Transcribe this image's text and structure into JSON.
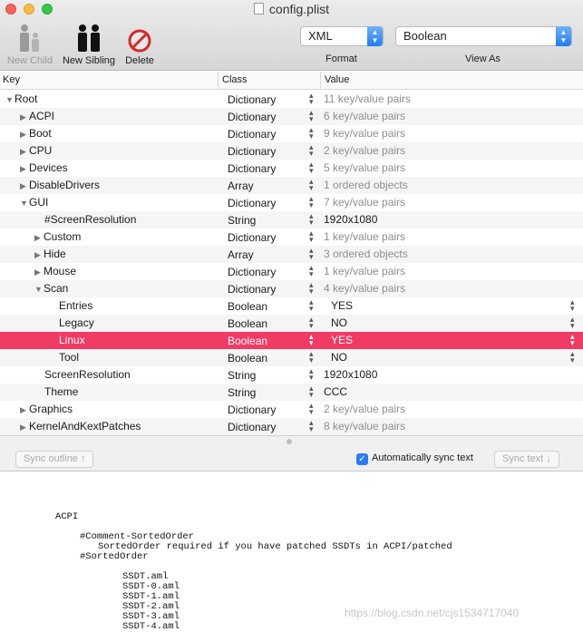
{
  "window": {
    "title": "config.plist"
  },
  "toolbar": {
    "new_child": "New Child",
    "new_sibling": "New Sibling",
    "delete": "Delete",
    "format_value": "XML",
    "format_caption": "Format",
    "viewas_value": "Boolean",
    "viewas_caption": "View As"
  },
  "columns": {
    "key": "Key",
    "class": "Class",
    "value": "Value"
  },
  "rows": [
    {
      "key": "Root",
      "class": "Dictionary",
      "value": "11 key/value pairs"
    },
    {
      "key": "ACPI",
      "class": "Dictionary",
      "value": "6 key/value pairs"
    },
    {
      "key": "Boot",
      "class": "Dictionary",
      "value": "9 key/value pairs"
    },
    {
      "key": "CPU",
      "class": "Dictionary",
      "value": "2 key/value pairs"
    },
    {
      "key": "Devices",
      "class": "Dictionary",
      "value": "5 key/value pairs"
    },
    {
      "key": "DisableDrivers",
      "class": "Array",
      "value": "1 ordered objects"
    },
    {
      "key": "GUI",
      "class": "Dictionary",
      "value": "7 key/value pairs"
    },
    {
      "key": "#ScreenResolution",
      "class": "String",
      "value": "1920x1080"
    },
    {
      "key": "Custom",
      "class": "Dictionary",
      "value": "1 key/value pairs"
    },
    {
      "key": "Hide",
      "class": "Array",
      "value": "3 ordered objects"
    },
    {
      "key": "Mouse",
      "class": "Dictionary",
      "value": "1 key/value pairs"
    },
    {
      "key": "Scan",
      "class": "Dictionary",
      "value": "4 key/value pairs"
    },
    {
      "key": "Entries",
      "class": "Boolean",
      "value": "YES"
    },
    {
      "key": "Legacy",
      "class": "Boolean",
      "value": "NO"
    },
    {
      "key": "Linux",
      "class": "Boolean",
      "value": "YES"
    },
    {
      "key": "Tool",
      "class": "Boolean",
      "value": "NO"
    },
    {
      "key": "ScreenResolution",
      "class": "String",
      "value": "1920x1080"
    },
    {
      "key": "Theme",
      "class": "String",
      "value": "CCC"
    },
    {
      "key": "Graphics",
      "class": "Dictionary",
      "value": "2 key/value pairs"
    },
    {
      "key": "KernelAndKextPatches",
      "class": "Dictionary",
      "value": "8 key/value pairs"
    }
  ],
  "sync": {
    "sync_outline": "Sync outline ↑",
    "auto_sync": "Automatically sync text",
    "sync_text": "Sync text ↓"
  },
  "text": {
    "l1": "ACPI",
    "l2": "#Comment-SortedOrder",
    "l3": "SortedOrder required if you have patched SSDTs in ACPI/patched",
    "l4": "#SortedOrder",
    "l5": "SSDT.aml",
    "l6": "SSDT-0.aml",
    "l7": "SSDT-1.aml",
    "l8": "SSDT-2.aml",
    "l9": "SSDT-3.aml",
    "l10": "SSDT-4.aml"
  },
  "watermark": "https://blog.csdn.net/cjs1534717040",
  "colors": {
    "selection": "#f03c64",
    "accent": "#2b7cf5"
  }
}
